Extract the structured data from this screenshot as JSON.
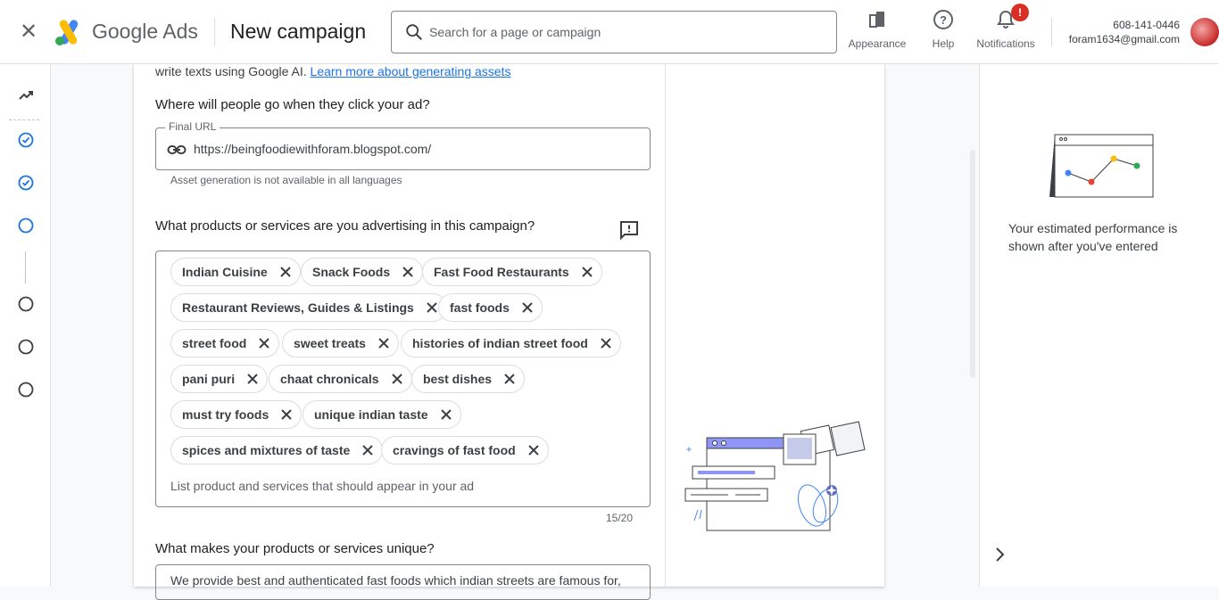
{
  "topbar": {
    "brand": "Google Ads",
    "page_title": "New campaign",
    "search_placeholder": "Search for a page or campaign",
    "actions": [
      {
        "label": "Appearance",
        "icon": "appearance-icon"
      },
      {
        "label": "Help",
        "icon": "help-icon"
      },
      {
        "label": "Notifications",
        "icon": "bell-icon",
        "badge": "!"
      }
    ],
    "account": {
      "id": "608-141-0446",
      "email": "foram1634@gmail.com"
    }
  },
  "rail": {
    "steps": [
      {
        "icon": "insights-icon",
        "state": "overview"
      },
      {
        "icon": "check-circle-icon",
        "state": "done"
      },
      {
        "icon": "check-circle-icon",
        "state": "done"
      },
      {
        "icon": "circle-icon",
        "state": "current"
      },
      {
        "icon": "circle-icon",
        "state": "todo"
      },
      {
        "icon": "circle-icon",
        "state": "todo"
      },
      {
        "icon": "circle-icon",
        "state": "todo"
      }
    ]
  },
  "form": {
    "intro_text": "write texts using Google AI. ",
    "intro_link": "Learn more about generating assets",
    "url_question": "Where will people go when they click your ad?",
    "url_label": "Final URL",
    "url_value": "https://beingfoodiewithforam.blogspot.com/",
    "url_hint": "Asset generation is not available in all languages",
    "products_question": "What products or services are you advertising in this campaign?",
    "chips": [
      "Indian Cuisine",
      "Snack Foods",
      "Fast Food Restaurants",
      "Restaurant Reviews, Guides & Listings",
      "fast foods",
      "street food",
      "sweet treats",
      "histories of indian street food",
      "pani puri",
      "chaat chronicals",
      "best dishes",
      "must try foods",
      "unique indian taste",
      "spices and mixtures of taste",
      "cravings of fast food"
    ],
    "chips_placeholder": "List product and services that should appear in your ad",
    "chips_counter": "15/20",
    "unique_question": "What makes your products or services unique?",
    "unique_value": "We provide best and authenticated fast foods which indian streets are famous for,"
  },
  "side_panel": {
    "text": "Your estimated performance is shown after you've entered"
  },
  "colors": {
    "accent": "#1a73e8",
    "badge": "#d93025",
    "border": "#80868b"
  }
}
